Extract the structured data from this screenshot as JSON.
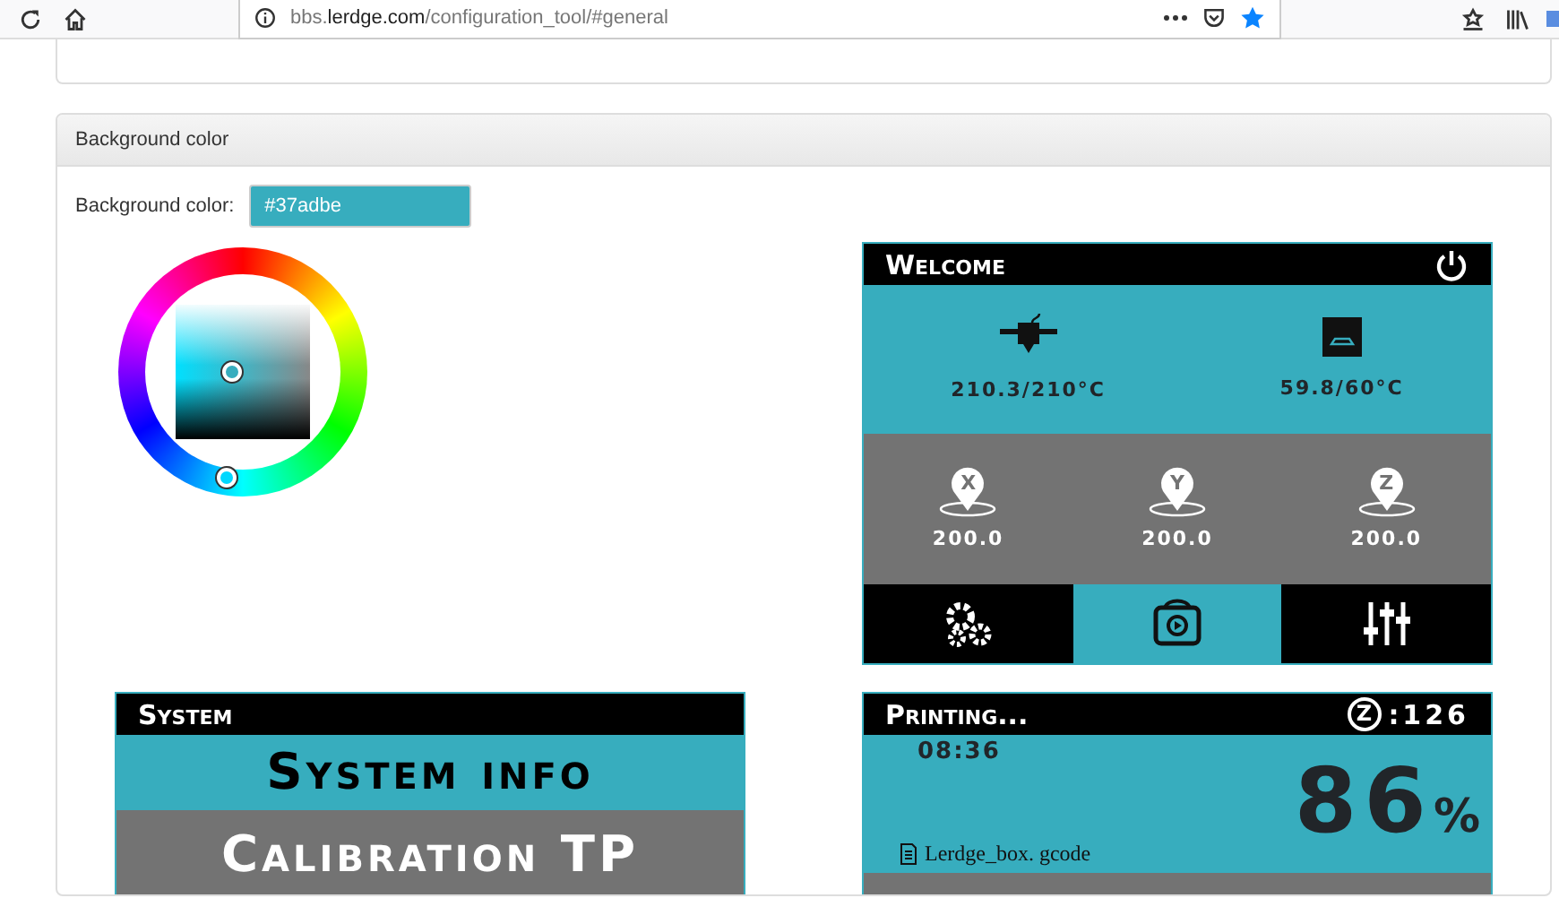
{
  "browser": {
    "url_prefix": "bbs.",
    "url_domain": "lerdge.com",
    "url_path": "/configuration_tool/#general",
    "bookmarked": true
  },
  "panel": {
    "title": "Background color",
    "field_label": "Background color:",
    "field_value": "#37adbe",
    "color": "#37adbe"
  },
  "screens": [
    {
      "kind": "welcome",
      "title": "Welcome",
      "temperatures": [
        {
          "reading": "210.3/210°C"
        },
        {
          "reading": "59.8/60°C"
        }
      ],
      "axes": [
        {
          "label": "X",
          "reading": "200.0"
        },
        {
          "label": "Y",
          "reading": "200.0"
        },
        {
          "label": "Z",
          "reading": "200.0"
        }
      ],
      "nav": [
        {
          "selected": false
        },
        {
          "selected": true
        },
        {
          "selected": false
        }
      ]
    },
    {
      "kind": "system",
      "title": "System",
      "items": [
        {
          "label": "System info",
          "selected": true
        },
        {
          "label": "Calibration TP",
          "selected": false
        }
      ]
    },
    {
      "kind": "printing",
      "title": "Printing...",
      "z_mark": "Z",
      "layer": ":126",
      "time": "08:36",
      "percent": "86",
      "percent_sign": "%",
      "file": "Lerdge_box. gcode"
    }
  ]
}
